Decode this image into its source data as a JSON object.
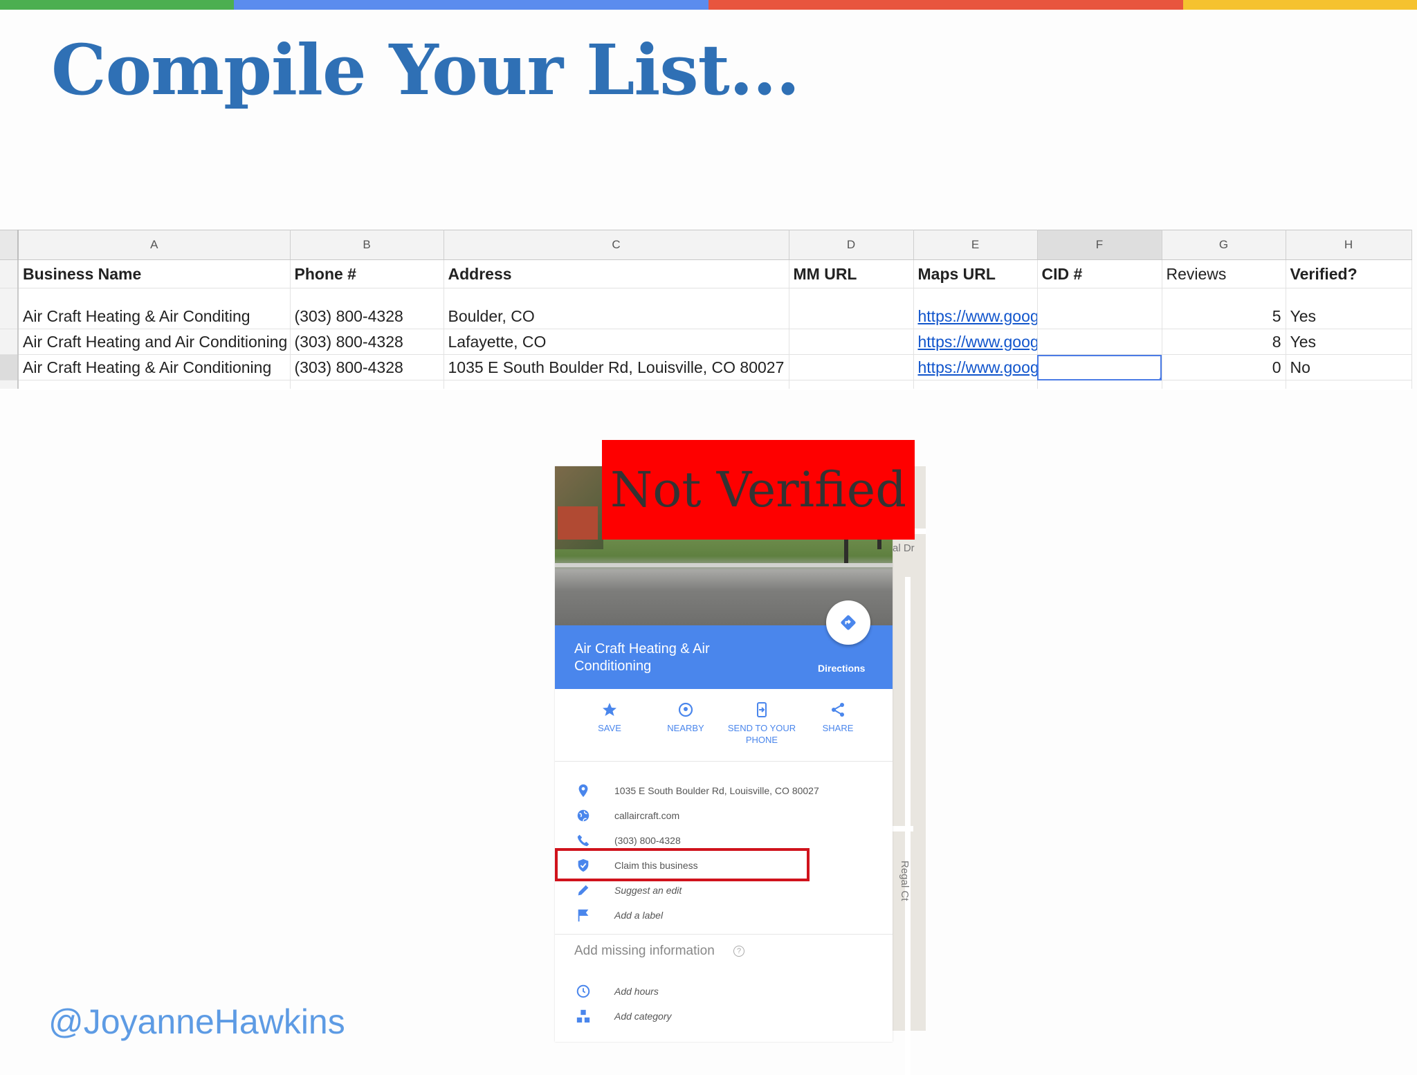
{
  "slide": {
    "title": "Compile Your List...",
    "handle": "@JoyanneHawkins",
    "stripe_colors": [
      "#4caf50",
      "#5b8cee",
      "#e8553e",
      "#f5c22f"
    ]
  },
  "spreadsheet": {
    "column_letters": [
      "A",
      "B",
      "C",
      "D",
      "E",
      "F",
      "G",
      "H"
    ],
    "headers": [
      "Business Name",
      "Phone #",
      "Address",
      "MM URL",
      "Maps URL",
      "CID #",
      "Reviews",
      "Verified?"
    ],
    "rows": [
      {
        "name": "Air Craft Heating & Air Conditing",
        "phone": "(303) 800-4328",
        "address": "Boulder, CO",
        "mm_url": "",
        "maps_url": "https://www.goog",
        "cid": "",
        "reviews": "5",
        "verified": "Yes"
      },
      {
        "name": "Air Craft Heating and Air Conditioning",
        "phone": "(303) 800-4328",
        "address": "Lafayette, CO",
        "mm_url": "",
        "maps_url": "https://www.goog",
        "cid": "",
        "reviews": "8",
        "verified": "Yes"
      },
      {
        "name": "Air Craft Heating & Air Conditioning",
        "phone": "(303) 800-4328",
        "address": "1035 E South Boulder Rd, Louisville, CO 80027",
        "mm_url": "",
        "maps_url": "https://www.goog",
        "cid": "",
        "reviews": "0",
        "verified": "No"
      }
    ],
    "selected_column": "F"
  },
  "maps_card": {
    "business_name": "Air Craft Heating & Air Conditioning",
    "directions_label": "Directions",
    "actions": [
      {
        "label": "SAVE",
        "icon": "star-icon"
      },
      {
        "label": "NEARBY",
        "icon": "nearby-icon"
      },
      {
        "label": "SEND TO YOUR PHONE",
        "icon": "send-to-phone-icon"
      },
      {
        "label": "SHARE",
        "icon": "share-icon"
      }
    ],
    "address": "1035 E South Boulder Rd, Louisville, CO 80027",
    "website": "callaircraft.com",
    "phone": "(303) 800-4328",
    "claim": "Claim this business",
    "suggest_edit": "Suggest an edit",
    "add_label": "Add a label",
    "missing_info": "Add missing information",
    "add_hours": "Add hours",
    "add_category": "Add category",
    "map_labels": [
      "al Dr",
      "Regal Ct"
    ],
    "accent_color": "#4a86ec"
  },
  "overlay": {
    "not_verified": "Not Verified",
    "color": "#fe0000"
  }
}
